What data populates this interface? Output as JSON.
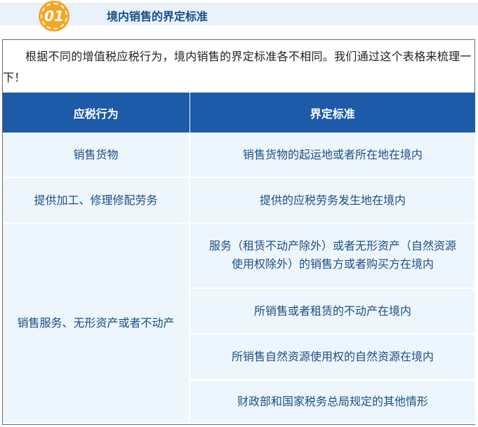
{
  "section": {
    "number": "01",
    "title": "境内销售的界定标准"
  },
  "intro": "根据不同的增值税应税行为，境内销售的界定标准各不相同。我们通过这个表格来梳理一下！",
  "table": {
    "headers": [
      "应税行为",
      "界定标准"
    ],
    "rows": [
      {
        "behavior": "销售货物",
        "standard": "销售货物的起运地或者所在地在境内"
      },
      {
        "behavior": "提供加工、修理修配劳务",
        "standard": "提供的应税劳务发生地在境内"
      },
      {
        "behavior": "销售服务、无形资产或者不动产",
        "standards": [
          "服务（租赁不动产除外）或者无形资产（自然资源使用权除外）的销售方或者购买方在境内",
          "所销售或者租赁的不动产在境内",
          "所销售自然资源使用权的自然资源在境内",
          "财政部和国家税务总局规定的其他情形"
        ]
      }
    ]
  },
  "colors": {
    "header_bg": "#1d5aa7",
    "cell_bg": "#eef6fd",
    "cell_text": "#1b4f86",
    "badge": "#f5a623",
    "title_text": "#1a4f8b"
  }
}
